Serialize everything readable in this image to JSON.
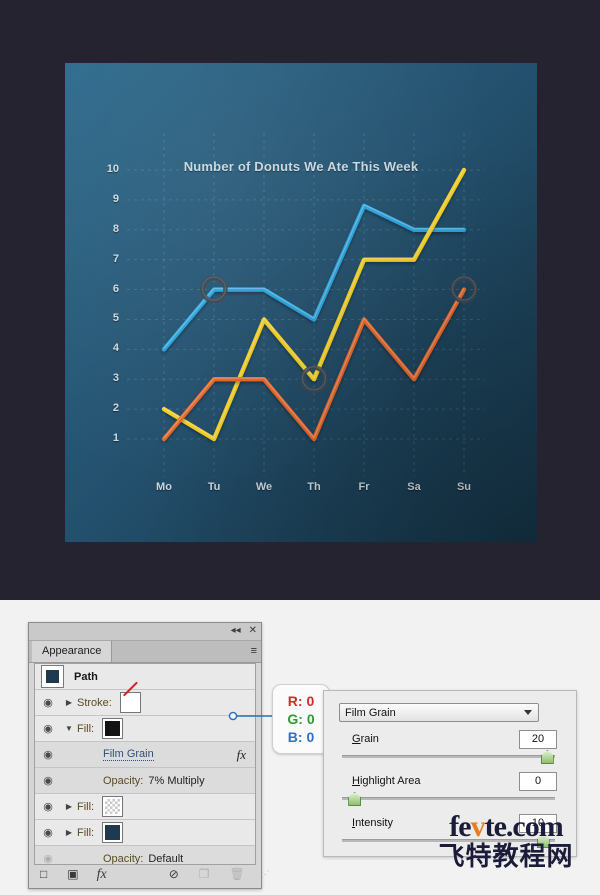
{
  "chart_data": {
    "type": "line",
    "title": "Number of Donuts We Ate This Week",
    "xlabel": "",
    "ylabel": "",
    "categories": [
      "Mo",
      "Tu",
      "We",
      "Th",
      "Fr",
      "Sa",
      "Su"
    ],
    "ylim": [
      0,
      10
    ],
    "yticks": [
      1,
      2,
      3,
      4,
      5,
      6,
      7,
      8,
      9,
      10
    ],
    "grid": true,
    "legend": "none",
    "series": [
      {
        "name": "Blue",
        "color": "#29a3dc",
        "values": [
          4,
          6,
          6,
          5,
          8.8,
          8,
          8
        ]
      },
      {
        "name": "Yellow",
        "color": "#f5d020",
        "values": [
          2,
          1,
          5,
          3,
          7,
          7,
          10
        ]
      },
      {
        "name": "Orange",
        "color": "#e8682a",
        "values": [
          1,
          3,
          3,
          1,
          5,
          3,
          6
        ]
      }
    ],
    "markers": [
      {
        "series": "Blue",
        "category": "Tu",
        "value": 6
      },
      {
        "series": "Yellow",
        "category": "Th",
        "value": 3
      },
      {
        "series": "Orange",
        "category": "Su",
        "value": 6
      }
    ],
    "panel_bg_top_left": "#2e6b8e",
    "panel_bg_bottom_right": "#153548",
    "page_bg": "#262331"
  },
  "appearance_panel": {
    "tab_label": "Appearance",
    "collapse_icon": "◂◂",
    "close_icon": "✕",
    "menu_icon": "≡",
    "object_label": "Path",
    "rows": [
      {
        "eye": "◉",
        "tri": "▶",
        "name": "Stroke:",
        "value": "",
        "swatch": "none"
      },
      {
        "eye": "◉",
        "tri": "▼",
        "name": "Fill:",
        "value": "",
        "swatch": "black"
      },
      {
        "eye": "◉",
        "tri": "",
        "name": "Film Grain",
        "value": "",
        "swatch": "",
        "fx": "fx"
      },
      {
        "eye": "◉",
        "tri": "",
        "name": "Opacity:",
        "value": "7% Multiply",
        "swatch": ""
      },
      {
        "eye": "◉",
        "tri": "▶",
        "name": "Fill:",
        "value": "",
        "swatch": "checker"
      },
      {
        "eye": "◉",
        "tri": "▶",
        "name": "Fill:",
        "value": "",
        "swatch": "navy"
      },
      {
        "eye": "◉",
        "tri": "",
        "name": "Opacity:",
        "value": "Default",
        "swatch": ""
      }
    ],
    "footer": {
      "add_stroke": "□",
      "add_fill": "▣",
      "fx": "fx",
      "clear": "⊘",
      "duplicate": "❐",
      "delete": "🗑",
      "grip": "⋰"
    }
  },
  "rgb_callout": {
    "r_label": "R:",
    "r_value": "0",
    "g_label": "G:",
    "g_value": "0",
    "b_label": "B:",
    "b_value": "0",
    "r_color": "#d32a2a",
    "g_color": "#2f9a37",
    "b_color": "#2f6fd0"
  },
  "film_grain_dialog": {
    "effect_name": "Film Grain",
    "fields": [
      {
        "label": "Grain",
        "underline": "G",
        "value": "20",
        "slider_pct": 97
      },
      {
        "label": "Highlight Area",
        "underline": "H",
        "value": "0",
        "slider_pct": 3
      },
      {
        "label": "Intensity",
        "underline": "I",
        "value": "10",
        "slider_pct": 95
      }
    ]
  },
  "watermark": {
    "english": "fevte.com",
    "chinese": "飞特教程网"
  }
}
